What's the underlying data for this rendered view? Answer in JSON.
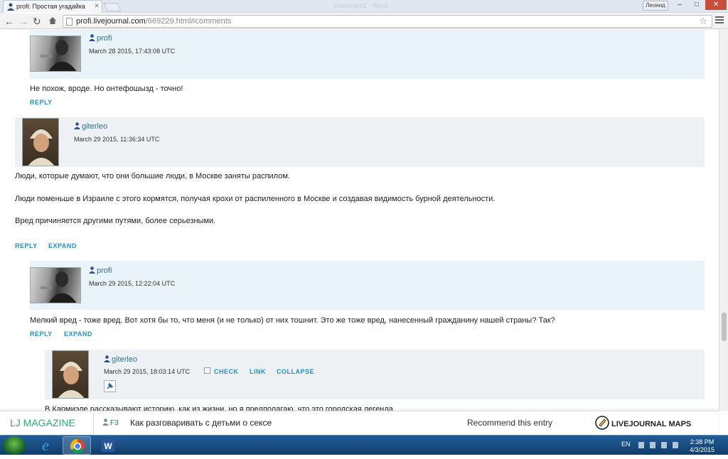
{
  "browser": {
    "tab_title": "profi: Простая угадайка",
    "tab_close": "×",
    "ghost_title": "Document1 - Word",
    "user_button": "Леонид",
    "min": "–",
    "max": "□",
    "close": "✕",
    "url_host": "profi.livejournal.com",
    "url_path": "/669229.html#comments"
  },
  "comments": [
    {
      "user": "profi",
      "date": "March 28 2015, 17:43:08 UTC",
      "text": [
        "Не похож, вроде. Но онтефошызд - точно!"
      ],
      "actions": [
        "REPLY"
      ]
    },
    {
      "user": "giterleo",
      "date": "March 29 2015, 11:36:34 UTC",
      "text": [
        "Люди, которые думают, что они большие люди, в Москве заняты распилом.",
        "Люди поменьше в Израиле с этого кормятся, получая крохи от распиленного в Москве и создавая видимость бурной деятельности.",
        "Вред причиняется другими путями, более серьезными."
      ],
      "actions": [
        "REPLY",
        "EXPAND"
      ]
    },
    {
      "user": "profi",
      "date": "March 29 2015, 12:22:04 UTC",
      "text": [
        "Мелкий вред - тоже вред. Вот хотя бы то, что меня (и не только) от них тошнит. Это же тоже вред, нанесенный гражданину нашей страны? Так?"
      ],
      "actions": [
        "REPLY",
        "EXPAND"
      ]
    },
    {
      "user": "giterleo",
      "date": "March 29 2015, 18:03:14 UTC",
      "text": [
        "В Кармиэле рассказывают историю, как из жизни, но я предполагаю, что это городская легенда."
      ],
      "actions": [
        "CHECK",
        "LINK",
        "COLLAPSE"
      ]
    }
  ],
  "ljbar": {
    "magazine": "LJ MAGAZINE",
    "f3": "F3",
    "article": "Как разговаривать с детьми о сексе",
    "recommend": "Recommend this entry",
    "maps": "LIVEJOURNAL MAPS"
  },
  "taskbar": {
    "lang": "EN",
    "time": "2:38 PM",
    "date": "4/3/2015"
  },
  "colors": {
    "accent": "#2a8fbd",
    "username": "#2f6f94",
    "magazine": "#3aa17e"
  }
}
